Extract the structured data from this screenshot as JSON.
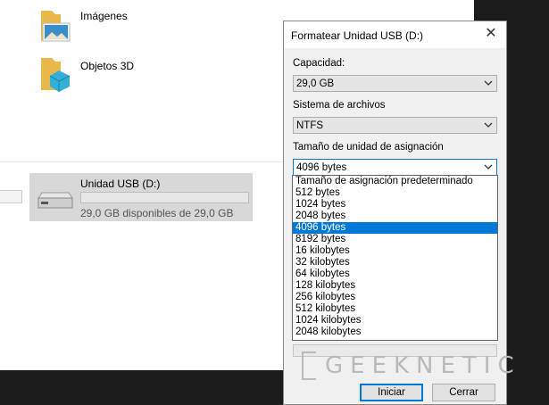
{
  "explorer": {
    "folders": [
      {
        "label": "Imágenes",
        "icon": "pictures-folder-icon"
      },
      {
        "label": "Objetos 3D",
        "icon": "3d-objects-folder-icon"
      }
    ],
    "drive": {
      "name": "Unidad USB (D:)",
      "free_text": "29,0 GB disponibles de 29,0 GB",
      "usage": 0.0,
      "icon": "usb-drive-icon"
    }
  },
  "dialog": {
    "title": "Formatear Unidad USB (D:)",
    "capacity": {
      "label": "Capacidad:",
      "value": "29,0 GB"
    },
    "filesystem": {
      "label": "Sistema de archivos",
      "value": "NTFS"
    },
    "allocation": {
      "label": "Tamaño de unidad de asignación",
      "value": "4096 bytes",
      "options": [
        "Tamaño de asignación predeterminado",
        "512 bytes",
        "1024 bytes",
        "2048 bytes",
        "4096 bytes",
        "8192 bytes",
        "16 kilobytes",
        "32 kilobytes",
        "64 kilobytes",
        "128 kilobytes",
        "256 kilobytes",
        "512 kilobytes",
        "1024 kilobytes",
        "2048 kilobytes"
      ],
      "selected_index": 4
    },
    "buttons": {
      "start": "Iniciar",
      "close": "Cerrar"
    }
  },
  "watermark": {
    "text": "GEEKNETIC"
  },
  "colors": {
    "accent": "#0078d7",
    "dialog_bg": "#f0f0f0",
    "desktop_bg": "#1b1b1b"
  }
}
